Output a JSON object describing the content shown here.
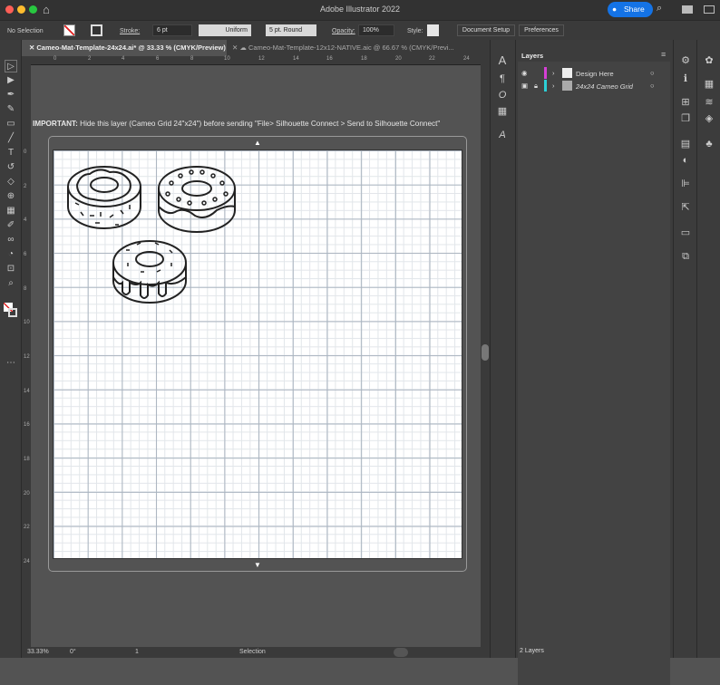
{
  "app": {
    "title": "Adobe Illustrator 2022",
    "share_label": "Share"
  },
  "control_bar": {
    "selection": "No Selection",
    "stroke_label": "Stroke:",
    "stroke_value": "6 pt",
    "profile": "Uniform",
    "brush": "5 pt. Round",
    "opacity_label": "Opacity:",
    "opacity_value": "100%",
    "style_label": "Style:",
    "document_setup": "Document Setup",
    "preferences": "Preferences"
  },
  "tabs": [
    {
      "label": "Cameo-Mat-Template-24x24.ai* @ 33.33 % (CMYK/Preview)",
      "active": true
    },
    {
      "label": "Cameo-Mat-Template-12x12-NATIVE.aic @ 66.67 % (CMYK/Previ...",
      "active": false
    }
  ],
  "ruler": {
    "top": [
      "0",
      "2",
      "4",
      "6",
      "8",
      "10",
      "12",
      "14",
      "16",
      "18",
      "20",
      "22",
      "24"
    ],
    "left": [
      "0",
      "2",
      "4",
      "6",
      "8",
      "10",
      "12",
      "14",
      "16",
      "18",
      "20",
      "22",
      "24"
    ]
  },
  "notice": {
    "bold": "IMPORTANT:",
    "text": " Hide this layer (Cameo Grid 24\"x24\") before sending \"File> Silhouette Connect > Send to Silhouette Connect\""
  },
  "layers_panel": {
    "title": "Layers",
    "layers": [
      {
        "name": "Design Here",
        "color": "#d63fd6",
        "visible": true,
        "locked": false
      },
      {
        "name": "24x24 Cameo Grid",
        "color": "#2ccfd6",
        "visible": true,
        "locked": true
      }
    ],
    "count": "2 Layers"
  },
  "status": {
    "zoom": "33.33%",
    "rotation": "0°",
    "artboard": "1",
    "tool": "Selection"
  },
  "colors": {
    "accent": "#1473e6",
    "panel": "#3c3c3c",
    "canvas": "#535353"
  }
}
